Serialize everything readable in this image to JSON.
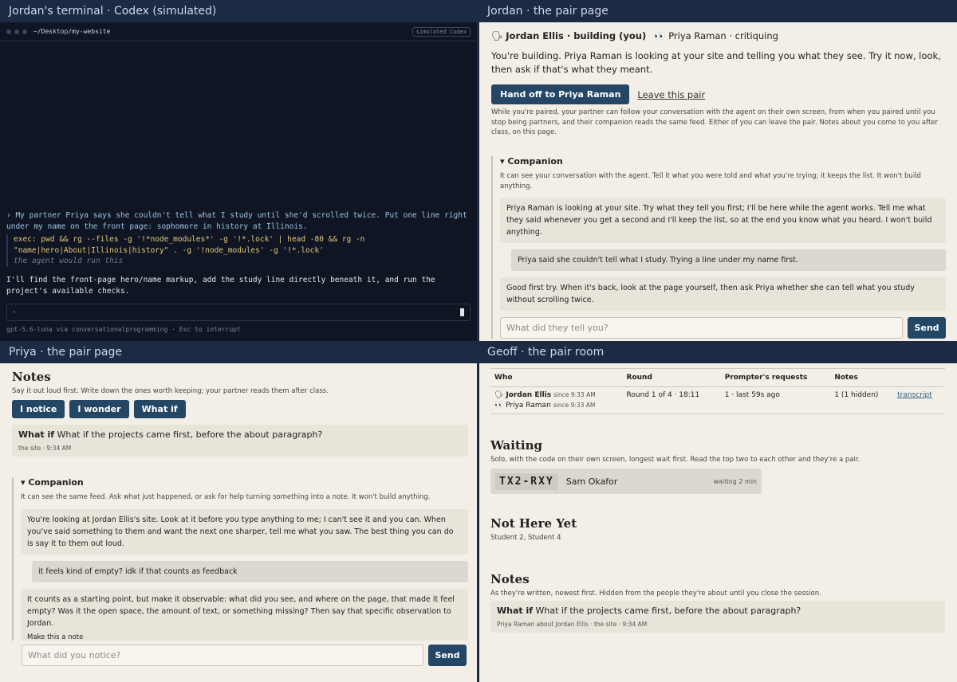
{
  "quadrants": {
    "q1_title": "Jordan's terminal · Codex (simulated)",
    "q2_title": "Jordan · the pair page",
    "q3_title": "Priya · the pair page",
    "q4_title": "Geoff · the pair room"
  },
  "terminal": {
    "path": "~/Desktop/my-website",
    "badge": "simulated Codex",
    "prompt": "› My partner Priya says she couldn't tell what I study until she'd scrolled twice. Put one line right under my name on the front page: sophomore in history at Illinois.",
    "exec_line1": "exec: pwd && rg --files -g '!*node_modules*' -g '!*.lock' | head -80 && rg -n",
    "exec_line2": "\"name|hero|About|Illinois|history\" . -g '!node_modules' -g '!*.lock'",
    "exec_note": "the agent would run this",
    "agent_reply": "I'll find the front-page hero/name markup, add the study line directly beneath it, and run the project's available checks.",
    "input_prompt": "›",
    "footer": "gpt-5.6-luna via conversationalprogramming  ·  Esc to interrupt"
  },
  "jordan": {
    "me": "Jordan Ellis · building (you)",
    "partner": "Priya Raman · critiquing",
    "lead": "You're building. Priya Raman is looking at your site and telling you what they see. Try it now, look, then ask if that's what they meant.",
    "handoff_label": "Hand off to Priya Raman",
    "leave_label": "Leave this pair",
    "small": "While you're paired, your partner can follow your conversation with the agent on their own screen, from when you paired until you stop being partners, and their companion reads the same feed. Either of you can leave the pair. Notes about you come to you after class, on this page.",
    "companion_title": "Companion",
    "companion_desc": "It can see your conversation with the agent. Tell it what you were told and what you're trying; it keeps the list. It won't build anything.",
    "msg1": "Priya Raman is looking at your site. Try what they tell you first; I'll be here while the agent works. Tell me what they said whenever you get a second and I'll keep the list, so at the end you know what you heard. I won't build anything.",
    "msg2": "Priya said she couldn't tell what I study. Trying a line under my name first.",
    "msg3": "Good first try. When it's back, look at the page yourself, then ask Priya whether she can tell what you study without scrolling twice.",
    "input_placeholder": "What did they tell you?",
    "send_label": "Send"
  },
  "priya": {
    "notes_title": "Notes",
    "notes_desc": "Say it out loud first. Write down the ones worth keeping; your partner reads them after class.",
    "tags": [
      "I notice",
      "I wonder",
      "What if"
    ],
    "note_prefix": "What if",
    "note_text": "What if the projects came first, before the about paragraph?",
    "note_meta": "the site · 9:34 AM",
    "companion_title": "Companion",
    "companion_desc": "It can see the same feed. Ask what just happened, or ask for help turning something into a note. It won't build anything.",
    "msg1": "You're looking at Jordan Ellis's site. Look at it before you type anything to me; I can't see it and you can. When you've said something to them and want the next one sharper, tell me what you saw. The best thing you can do is say it to them out loud.",
    "msg2": "it feels kind of empty? idk if that counts as feedback",
    "msg3": "It counts as a starting point, but make it observable: what did you see, and where on the page, that made it feel empty? Was it the open space, the amount of text, or something missing? Then say that specific observation to Jordan.",
    "msg3_action": "Make this a note",
    "input_placeholder": "What did you notice?",
    "send_label": "Send"
  },
  "geoff": {
    "table_headers": [
      "Who",
      "Round",
      "Prompter's requests",
      "Notes",
      ""
    ],
    "row": {
      "who1": "Jordan Ellis",
      "since1": "since 9:33 AM",
      "who2": "Priya Raman",
      "since2": "since 9:33 AM",
      "round": "Round 1 of 4 · 18:11",
      "requests": "1 · last 59s ago",
      "notes": "1 (1 hidden)",
      "link": "transcript"
    },
    "waiting_title": "Waiting",
    "waiting_desc": "Solo, with the code on their own screen, longest wait first. Read the top two to each other and they're a pair.",
    "wait_code": "TX2-RXY",
    "wait_name": "Sam Okafor",
    "wait_time": "waiting 2 min",
    "absent_title": "Not Here Yet",
    "absent_list": "Student 2, Student 4",
    "notes_title": "Notes",
    "notes_desc": "As they're written, newest first. Hidden from the people they're about until you close the session.",
    "note_prefix": "What if",
    "note_text": "What if the projects came first, before the about paragraph?",
    "note_meta": "Priya Raman about Jordan Ellis · the site · 9:34 AM"
  },
  "icons": {
    "building": "speech-head-icon",
    "critiquing": "eyes-icon"
  },
  "colors": {
    "accent": "#254766",
    "terminal_bg": "#0f1522",
    "page_bg": "#f3efe6",
    "title_bar": "#1c2a44"
  }
}
